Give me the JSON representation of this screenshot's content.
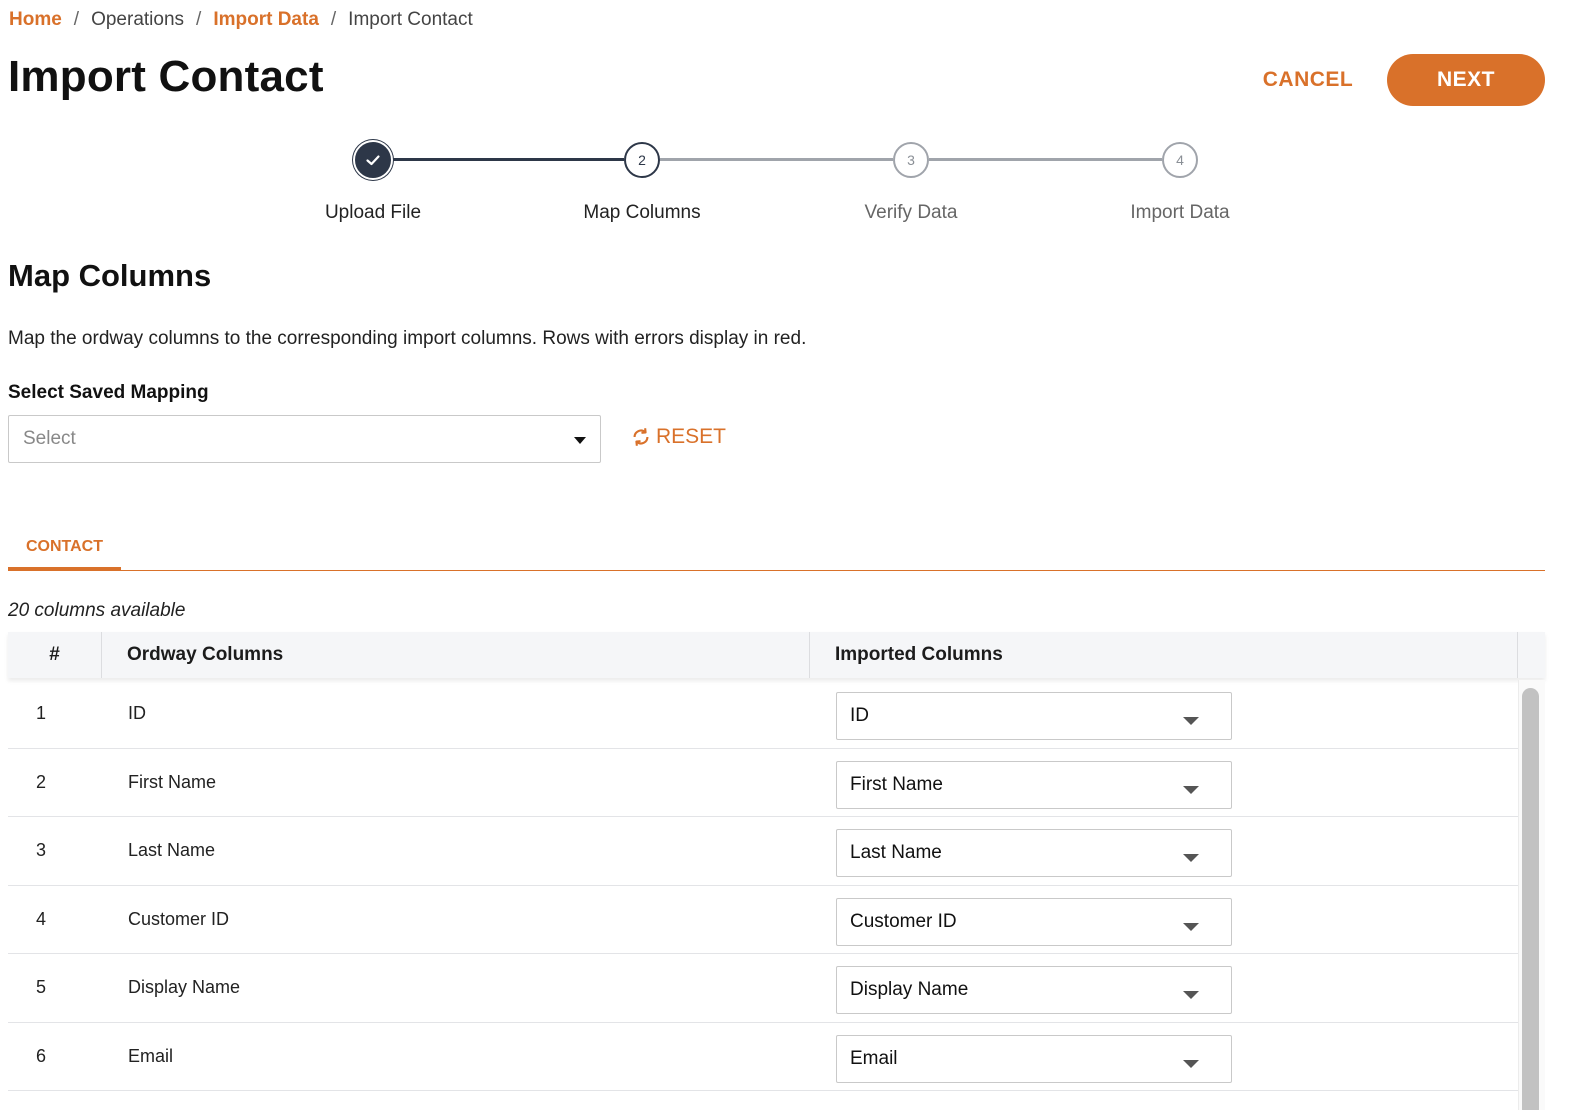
{
  "breadcrumb": {
    "home": "Home",
    "operations": "Operations",
    "import_data": "Import Data",
    "current": "Import Contact",
    "separator": "/"
  },
  "page_title": "Import Contact",
  "actions": {
    "cancel": "CANCEL",
    "next": "NEXT"
  },
  "stepper": {
    "steps": [
      {
        "label": "Upload File",
        "number": "1",
        "state": "complete"
      },
      {
        "label": "Map Columns",
        "number": "2",
        "state": "active"
      },
      {
        "label": "Verify Data",
        "number": "3",
        "state": "pending"
      },
      {
        "label": "Import Data",
        "number": "4",
        "state": "pending"
      }
    ]
  },
  "section": {
    "title": "Map Columns",
    "description": "Map the ordway columns to the corresponding import columns. Rows with errors display in red."
  },
  "saved_mapping": {
    "label": "Select Saved Mapping",
    "placeholder": "Select",
    "reset_label": "RESET"
  },
  "tabs": [
    {
      "label": "CONTACT",
      "active": true
    }
  ],
  "table": {
    "count_text": "20 columns available",
    "headers": {
      "num": "#",
      "ordway": "Ordway Columns",
      "imported": "Imported Columns"
    },
    "rows": [
      {
        "num": "1",
        "ordway": "ID",
        "imported": "ID"
      },
      {
        "num": "2",
        "ordway": "First Name",
        "imported": "First Name"
      },
      {
        "num": "3",
        "ordway": "Last Name",
        "imported": "Last Name"
      },
      {
        "num": "4",
        "ordway": "Customer ID",
        "imported": "Customer ID"
      },
      {
        "num": "5",
        "ordway": "Display Name",
        "imported": "Display Name"
      },
      {
        "num": "6",
        "ordway": "Email",
        "imported": "Email"
      }
    ]
  },
  "colors": {
    "accent": "#d9712a",
    "step_complete": "#2d3748",
    "step_pending": "#a0a4ab"
  },
  "icons": {
    "check": "check-icon",
    "reset": "refresh-icon",
    "dropdown": "caret-down-icon"
  }
}
